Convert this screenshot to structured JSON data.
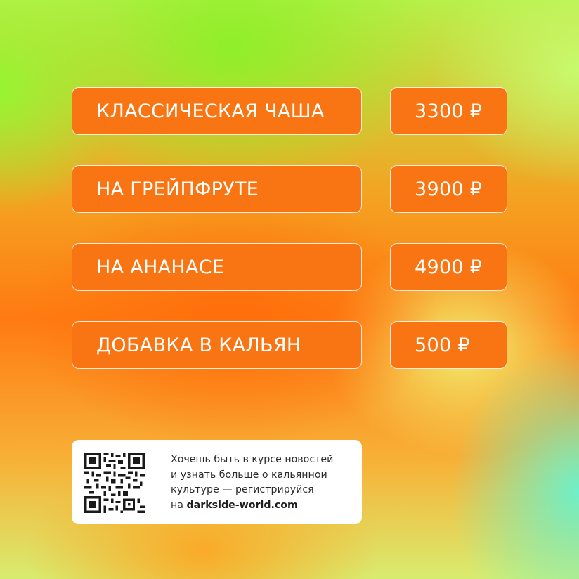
{
  "menu": {
    "items": [
      {
        "name": "КЛАССИЧЕСКАЯ ЧАША",
        "price": "3300 ₽"
      },
      {
        "name": "НА ГРЕЙПФРУТЕ",
        "price": "3900 ₽"
      },
      {
        "name": "НА АНАНАСЕ",
        "price": "4900 ₽"
      },
      {
        "name": "ДОБАВКА В КАЛЬЯН",
        "price": "500 ₽"
      }
    ]
  },
  "info": {
    "line1": "Хочешь быть в курсе новостей",
    "line2": "и узнать больше о кальянной",
    "line3": "культуре — регистрируйся",
    "line4_prefix": "на ",
    "website": "darkside-world.com"
  },
  "colors": {
    "pill": "#f97412",
    "pill_border": "#ffffff",
    "text_on_pill": "#ffffff",
    "card_bg": "#ffffff"
  },
  "icons": {
    "qr": "qr-code-icon"
  }
}
